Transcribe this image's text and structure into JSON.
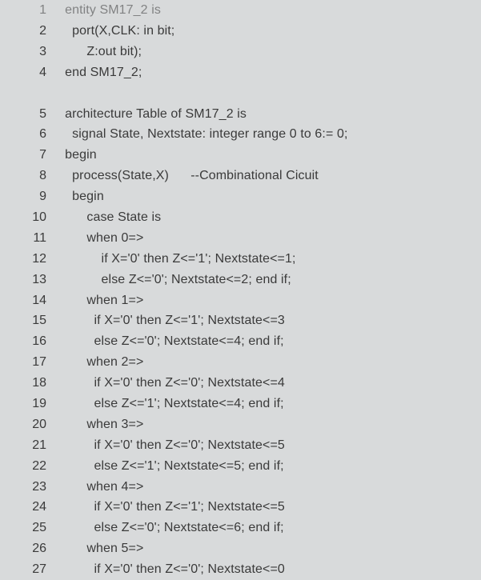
{
  "lines": [
    {
      "n": "1",
      "indent": 1,
      "text": "entity SM17_2 is",
      "faded": true
    },
    {
      "n": "2",
      "indent": 2,
      "text": "port(X,CLK: in bit;"
    },
    {
      "n": "3",
      "indent": 4,
      "text": "Z:out bit);"
    },
    {
      "n": "4",
      "indent": 1,
      "text": "end SM17_2;"
    },
    {
      "gap": true
    },
    {
      "n": "5",
      "indent": 1,
      "text": "architecture Table of SM17_2 is"
    },
    {
      "n": "6",
      "indent": 2,
      "text": "signal State, Nextstate: integer range 0 to 6:= 0;"
    },
    {
      "n": "7",
      "indent": 1,
      "text": "begin"
    },
    {
      "n": "8",
      "indent": 2,
      "text": "process(State,X)      --Combinational Cicuit"
    },
    {
      "n": "9",
      "indent": 2,
      "text": "begin"
    },
    {
      "n": "10",
      "indent": 4,
      "text": "case State is"
    },
    {
      "n": "11",
      "indent": 4,
      "text": "when 0=>"
    },
    {
      "n": "12",
      "indent": 6,
      "text": "if X='0' then Z<='1'; Nextstate<=1;"
    },
    {
      "n": "13",
      "indent": 6,
      "text": "else Z<='0'; Nextstate<=2; end if;"
    },
    {
      "n": "14",
      "indent": 4,
      "text": "when 1=>"
    },
    {
      "n": "15",
      "indent": 5,
      "text": "if X='0' then Z<='1'; Nextstate<=3"
    },
    {
      "n": "16",
      "indent": 5,
      "text": "else Z<='0'; Nextstate<=4; end if;"
    },
    {
      "n": "17",
      "indent": 4,
      "text": "when 2=>"
    },
    {
      "n": "18",
      "indent": 5,
      "text": "if X='0' then Z<='0'; Nextstate<=4"
    },
    {
      "n": "19",
      "indent": 5,
      "text": "else Z<='1'; Nextstate<=4; end if;"
    },
    {
      "n": "20",
      "indent": 4,
      "text": "when 3=>"
    },
    {
      "n": "21",
      "indent": 5,
      "text": "if X='0' then Z<='0'; Nextstate<=5"
    },
    {
      "n": "22",
      "indent": 5,
      "text": "else Z<='1'; Nextstate<=5; end if;"
    },
    {
      "n": "23",
      "indent": 4,
      "text": "when 4=>"
    },
    {
      "n": "24",
      "indent": 5,
      "text": "if X='0' then Z<='1'; Nextstate<=5"
    },
    {
      "n": "25",
      "indent": 5,
      "text": "else Z<='0'; Nextstate<=6; end if;"
    },
    {
      "n": "26",
      "indent": 4,
      "text": "when 5=>"
    },
    {
      "n": "27",
      "indent": 5,
      "text": "if X='0' then Z<='0'; Nextstate<=0"
    }
  ],
  "indent_unit": "  "
}
